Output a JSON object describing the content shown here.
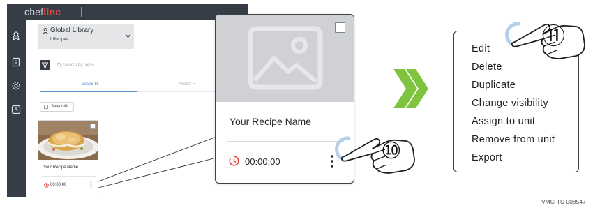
{
  "app": {
    "logo_prefix": "chef",
    "logo_brand": "linc",
    "library": {
      "title": "Global Library",
      "count": "1 Recipes"
    },
    "search": {
      "placeholder": "Search by name"
    },
    "tabs": [
      {
        "label": "Vector H."
      },
      {
        "label": "Vector F"
      }
    ],
    "select_all_label": "Select All",
    "sidebar_icons": [
      "user-badge-icon",
      "document-icon",
      "settings-gear-icon",
      "history-icon"
    ]
  },
  "recipe_card": {
    "name": "Your Recipe Name",
    "time": "00:00:00",
    "time_icon": "clock-icon",
    "menu_icon": "kebab-icon"
  },
  "context_menu": {
    "items": [
      {
        "label": "Edit"
      },
      {
        "label": "Delete"
      },
      {
        "label": "Duplicate"
      },
      {
        "label": "Change visibility"
      },
      {
        "label": "Assign to unit"
      },
      {
        "label": "Remove from unit"
      },
      {
        "label": "Export"
      }
    ]
  },
  "steps": [
    {
      "number": "⑩"
    },
    {
      "number": "⑪"
    }
  ],
  "colors": {
    "topbar": "#363d46",
    "brand_red": "#e84a3c",
    "accent_blue": "#5b8fd0",
    "arrow_green": "#7ec43e",
    "clock_red": "#e03b2e",
    "placeholder_gray": "#cfd1d4"
  },
  "footer_code": "VMC-TS-008547"
}
